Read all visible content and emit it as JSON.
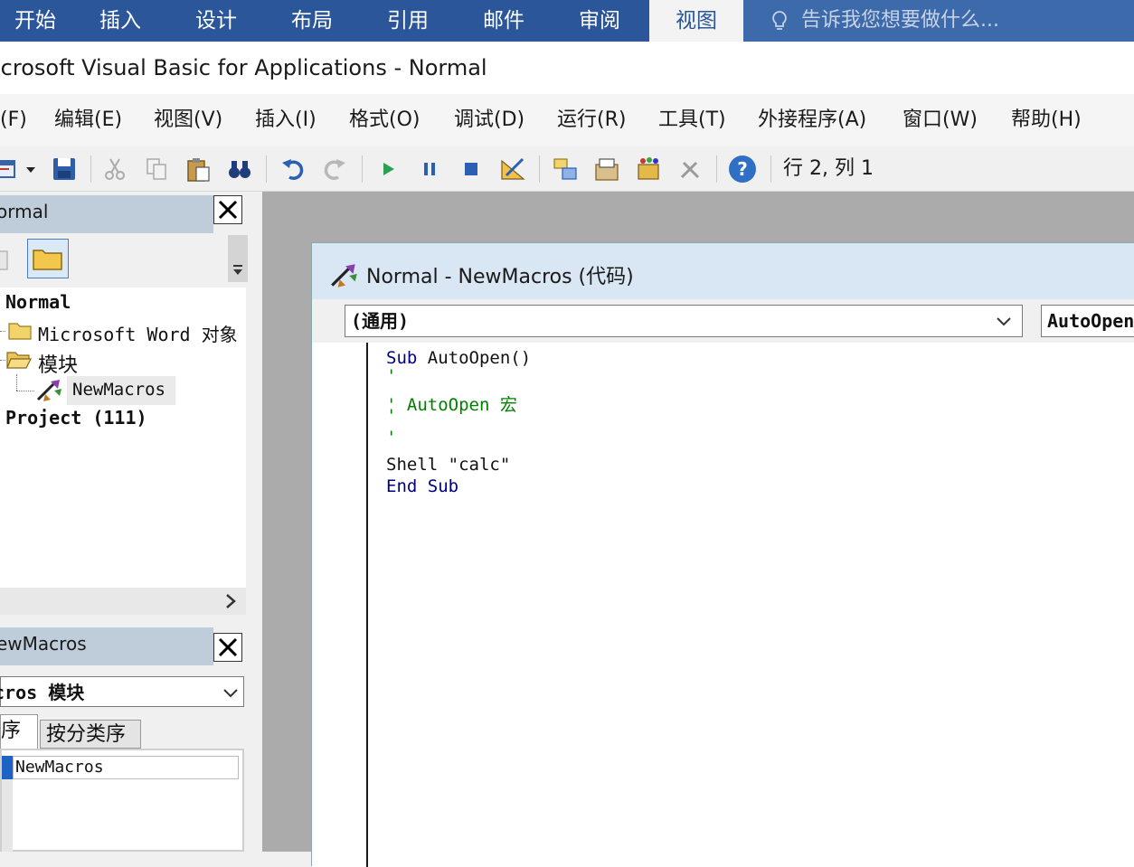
{
  "ribbon": {
    "tabs": [
      {
        "label": "开始",
        "active": false
      },
      {
        "label": "插入",
        "active": false
      },
      {
        "label": "设计",
        "active": false
      },
      {
        "label": "布局",
        "active": false
      },
      {
        "label": "引用",
        "active": false
      },
      {
        "label": "邮件",
        "active": false
      },
      {
        "label": "审阅",
        "active": false
      },
      {
        "label": "视图",
        "active": true
      }
    ],
    "tell_me": "告诉我您想要做什么...",
    "tell_me_icon": "lightbulb-icon",
    "bg_color": "#2b579a"
  },
  "window": {
    "title": "icrosoft Visual Basic for Applications - Normal"
  },
  "menubar": {
    "items": [
      "(F)",
      "编辑(E)",
      "视图(V)",
      "插入(I)",
      "格式(O)",
      "调试(D)",
      "运行(R)",
      "工具(T)",
      "外接程序(A)",
      "窗口(W)",
      "帮助(H)"
    ]
  },
  "toolbar": {
    "buttons": [
      "view-word-icon",
      "dropdown-arrow-icon",
      "save-icon",
      "cut-icon",
      "copy-icon",
      "paste-icon",
      "find-icon",
      "undo-icon",
      "redo-icon",
      "run-icon",
      "pause-icon",
      "stop-icon",
      "design-mode-icon",
      "project-explorer-icon",
      "properties-icon",
      "object-browser-icon",
      "toolbox-icon",
      "help-icon"
    ],
    "position": "行 2, 列 1"
  },
  "project_pane": {
    "title": "ormal",
    "tree": {
      "root": "Normal",
      "folder_word_objects": "Microsoft Word 对象",
      "folder_modules": "模块",
      "module_newmacros": "NewMacros",
      "project_111": "Project (111)"
    }
  },
  "properties_pane": {
    "title": "ewMacros",
    "object_select": "cros 模块",
    "tabs": [
      "序",
      "按分类序"
    ],
    "row_value": "NewMacros"
  },
  "code_window": {
    "title": "Normal - NewMacros (代码)",
    "object_combo": "(通用)",
    "proc_combo": "AutoOpen",
    "lines": {
      "l1_kw": "Sub",
      "l1_rest": " AutoOpen()",
      "l2": "'",
      "l3": "' AutoOpen 宏",
      "l4": "'",
      "l5": "'",
      "l6": "Shell \"calc\"",
      "l7": "End Sub"
    }
  }
}
